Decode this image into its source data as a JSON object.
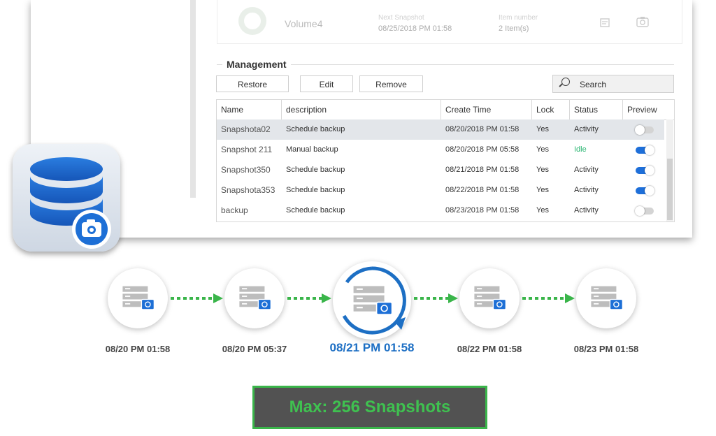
{
  "volume_card": {
    "name": "Volume4",
    "next_snapshot_label": "Next Snapshot",
    "next_snapshot_value": "08/25/2018 PM 01:58",
    "item_number_label": "Item number",
    "item_number_value": "2 Item(s)"
  },
  "management": {
    "title": "Management",
    "buttons": {
      "restore": "Restore",
      "edit": "Edit",
      "remove": "Remove"
    },
    "search_placeholder": "Search"
  },
  "table": {
    "columns": [
      "Name",
      "description",
      "Create Time",
      "Lock",
      "Status",
      "Preview"
    ],
    "rows": [
      {
        "name": "Snapshota02",
        "description": "Schedule backup",
        "create_time": "08/20/2018 PM 01:58",
        "lock": "Yes",
        "status": "Activity",
        "preview_on": false
      },
      {
        "name": "Snapshot 211",
        "description": "Manual backup",
        "create_time": "08/20/2018 PM 05:58",
        "lock": "Yes",
        "status": "Idle",
        "preview_on": true
      },
      {
        "name": "Snapshot350",
        "description": "Schedule backup",
        "create_time": "08/21/2018 PM 01:58",
        "lock": "Yes",
        "status": "Activity",
        "preview_on": true
      },
      {
        "name": "Snapshota353",
        "description": "Schedule backup",
        "create_time": "08/22/2018 PM 01:58",
        "lock": "Yes",
        "status": "Activity",
        "preview_on": true
      },
      {
        "name": "backup",
        "description": "Schedule backup",
        "create_time": "08/23/2018 PM 01:58",
        "lock": "Yes",
        "status": "Activity",
        "preview_on": false
      }
    ]
  },
  "timeline": {
    "nodes": [
      {
        "date": "08/20 PM 01:58"
      },
      {
        "date": "08/20 PM 05:37"
      },
      {
        "date": "08/21 PM 01:58",
        "active": true
      },
      {
        "date": "08/22 PM 01:58"
      },
      {
        "date": "08/23 PM 01:58"
      }
    ]
  },
  "max_label": "Max: 256 Snapshots",
  "colors": {
    "accent_blue": "#1d6fc4",
    "status_idle": "#2bb673",
    "arrow_green": "#3ab54a",
    "toggle_on": "#1e6fd9",
    "toggle_off": "#d4d4d4"
  },
  "icons": {
    "app": "database-camera-icon",
    "snapshot": "server-camera-icon",
    "search": "search-icon",
    "calendar": "calendar-icon",
    "camera": "camera-icon"
  }
}
